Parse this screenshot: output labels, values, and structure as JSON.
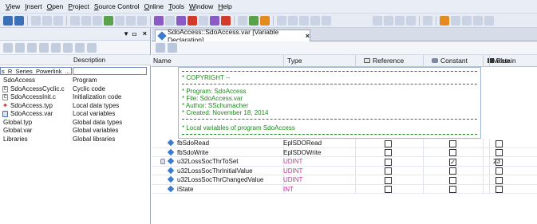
{
  "menu": [
    {
      "label": "View",
      "u": "V",
      "rest": "iew"
    },
    {
      "label": "Insert",
      "u": "I",
      "rest": "nsert"
    },
    {
      "label": "Open",
      "u": "O",
      "rest": "pen"
    },
    {
      "label": "Project",
      "u": "P",
      "rest": "roject"
    },
    {
      "label": "Source Control",
      "u": "S",
      "rest": "ource Control"
    },
    {
      "label": "Online",
      "u": "O",
      "rest": "nline"
    },
    {
      "label": "Tools",
      "u": "T",
      "rest": "ools"
    },
    {
      "label": "Window",
      "u": "W",
      "rest": "indow"
    },
    {
      "label": "Help",
      "u": "H",
      "rest": "elp"
    }
  ],
  "left_panel": {
    "close_glyph": "×",
    "column_header": "Description",
    "path_value": "s_R_Series_Powerlink_...",
    "items": [
      {
        "name": "SdoAccess",
        "desc": "Program",
        "icon": "none",
        "indent": 4
      },
      {
        "name": "SdoAccessCyclic.c",
        "desc": "Cyclic code",
        "icon": "c-file-icon",
        "indent": 13
      },
      {
        "name": "SdoAccessInit.c",
        "desc": "Initialization code",
        "icon": "c-file-icon",
        "indent": 13
      },
      {
        "name": "SdoAccess.typ",
        "desc": "Local data types",
        "icon": "typ-file-icon",
        "indent": 13
      },
      {
        "name": "SdoAccess.var",
        "desc": "Local variables",
        "icon": "var-file-icon",
        "indent": 13
      },
      {
        "name": "Global.typ",
        "desc": "Global data types",
        "icon": "none",
        "indent": 4
      },
      {
        "name": "Global.var",
        "desc": "Global variables",
        "icon": "none",
        "indent": 4
      },
      {
        "name": "Libraries",
        "desc": "Global libraries",
        "icon": "none",
        "indent": 4
      }
    ]
  },
  "editor": {
    "tab_label": "SdoAccess::SdoAccess.var [Variable Declaration]",
    "tab_close": "×",
    "columns": {
      "name": "Name",
      "type": "Type",
      "reference": "Reference",
      "constant": "Constant",
      "retain": "Retain",
      "value": "Value"
    },
    "comment": {
      "copyright": "* COPYRIGHT --",
      "program": "* Program: SdoAccess",
      "file": "* File: SdoAccess.var",
      "author": "* Author: SSchumacher",
      "created": "* Created: November 18, 2014",
      "local": "* Local variables of program SdoAccess"
    },
    "rows": [
      {
        "name": "fbSdoRead",
        "type": "EplSDORead",
        "type_kind": "fb",
        "reference": "☐",
        "constant": "☐",
        "retain": "☐",
        "value": "",
        "locked": false
      },
      {
        "name": "fbSdoWrite",
        "type": "EplSDOWrite",
        "type_kind": "fb",
        "reference": "☐",
        "constant": "☐",
        "retain": "☐",
        "value": "",
        "locked": false
      },
      {
        "name": "u32LossSocThrToSet",
        "type": "UDINT",
        "type_kind": "basic",
        "reference": "☐",
        "constant": "☑",
        "retain": "☐",
        "value": "23",
        "locked": true
      },
      {
        "name": "u32LossSocThrInitialValue",
        "type": "UDINT",
        "type_kind": "basic",
        "reference": "☐",
        "constant": "☐",
        "retain": "☐",
        "value": "",
        "locked": false
      },
      {
        "name": "u32LossSocThrChangedValue",
        "type": "UDINT",
        "type_kind": "basic",
        "reference": "☐",
        "constant": "☐",
        "retain": "☐",
        "value": "",
        "locked": false
      },
      {
        "name": "iState",
        "type": "INT",
        "type_kind": "basic",
        "reference": "☐",
        "constant": "☐",
        "retain": "☐",
        "value": "",
        "locked": false
      }
    ]
  },
  "colors": {
    "comment_green": "#1d8a1d",
    "basic_type_magenta": "#d62ba0",
    "accent_blue": "#3b7ad0"
  }
}
